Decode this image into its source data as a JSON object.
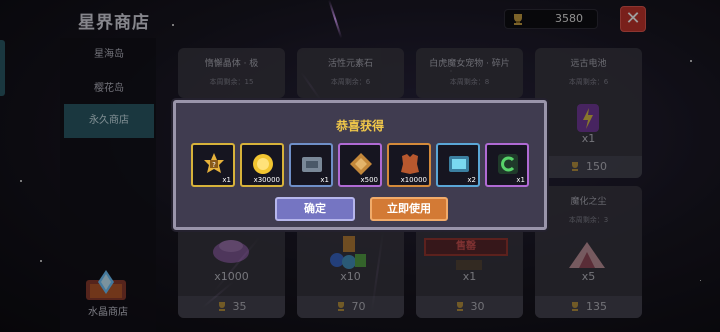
{
  "shop": {
    "title": "星界商店",
    "currency_value": "3580",
    "close_label": "✕",
    "tabs": [
      {
        "label": "星海岛"
      },
      {
        "label": "樱花岛"
      },
      {
        "label": "永久商店"
      }
    ],
    "crystal_label": "水晶商店"
  },
  "cards_top": [
    {
      "name": "惰懈晶体 · 极",
      "remain": "本周剩余：15"
    },
    {
      "name": "活性元素石",
      "remain": "本周剩余：6"
    },
    {
      "name": "白虎魔女宠物 · 碎片",
      "remain": "本周剩余：8"
    },
    {
      "name": "远古电池",
      "remain": "本周剩余：6",
      "qty": "x1",
      "price": "150"
    }
  ],
  "cards_bottom": [
    {
      "qty": "x1000",
      "price": "35"
    },
    {
      "qty": "x10",
      "price": "70"
    },
    {
      "sold_label": "售罄",
      "qty": "x1",
      "price": "30"
    },
    {
      "name": "魔化之尘",
      "remain": "本周剩余：3",
      "qty": "x5",
      "price": "135"
    }
  ],
  "dialog": {
    "title": "恭喜获得",
    "items": [
      {
        "icon": "trophy-badge-icon",
        "count": "x1",
        "border": "#d7b23a"
      },
      {
        "icon": "gold-coin-icon",
        "count": "x30000",
        "border": "#d7b23a"
      },
      {
        "icon": "metal-chest-icon",
        "count": "x1",
        "border": "#6f8fc8"
      },
      {
        "icon": "bronze-crystal-icon",
        "count": "x500",
        "border": "#b06ad4"
      },
      {
        "icon": "leather-hide-icon",
        "count": "x10000",
        "border": "#d48a3a"
      },
      {
        "icon": "cyan-device-icon",
        "count": "x2",
        "border": "#5aa6d6"
      },
      {
        "icon": "green-swirl-icon",
        "count": "x1",
        "border": "#b06ad4"
      }
    ],
    "confirm_label": "确定",
    "use_label": "立即使用"
  }
}
